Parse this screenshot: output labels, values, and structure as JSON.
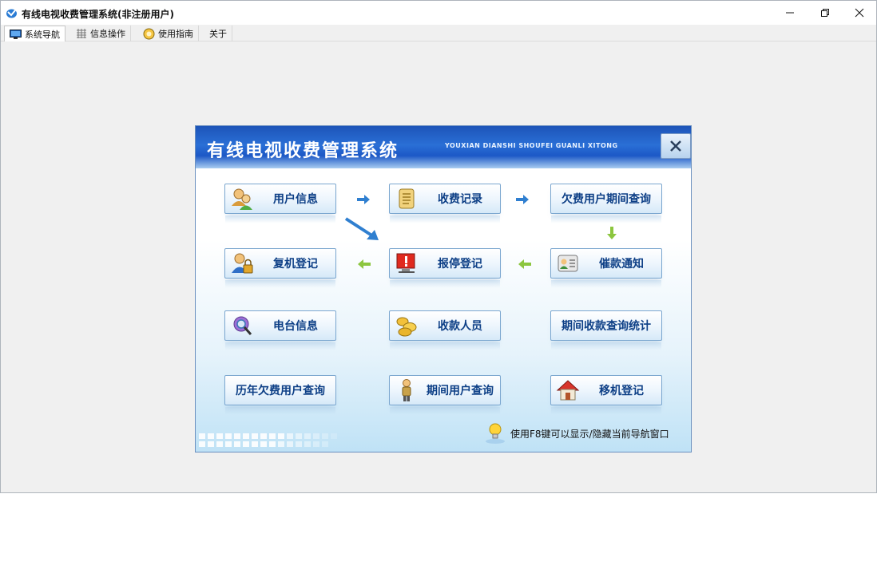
{
  "window": {
    "title": "有线电视收费管理系统(非注册用户)"
  },
  "menu": [
    {
      "label": "系统导航",
      "icon": "monitor-icon",
      "active": true
    },
    {
      "label": "信息操作",
      "icon": "grid-icon",
      "active": false
    },
    {
      "label": "使用指南",
      "icon": "help-icon",
      "active": false
    },
    {
      "label": "关于",
      "icon": "",
      "active": false
    }
  ],
  "nav": {
    "title": "有线电视收费管理系统",
    "subtitle": "YOUXIAN DIANSHI SHOUFEI GUANLI XITONG",
    "buttons": {
      "user_info": "用户信息",
      "fee_records": "收费记录",
      "arrears_query": "欠费用户期间查询",
      "reconnect": "复机登记",
      "suspend": "报停登记",
      "reminder": "催款通知",
      "station_info": "电台信息",
      "collectors": "收款人员",
      "period_stats": "期间收款查询统计",
      "yearly_arrears": "历年欠费用户查询",
      "period_users": "期间用户查询",
      "relocate": "移机登记"
    },
    "hint": "使用F8键可以显示/隐藏当前导航窗口"
  },
  "colors": {
    "header_blue": "#1d54b8",
    "button_text": "#0d3f86",
    "arrow_blue": "#2f7fd0",
    "arrow_green": "#8cc63f"
  }
}
